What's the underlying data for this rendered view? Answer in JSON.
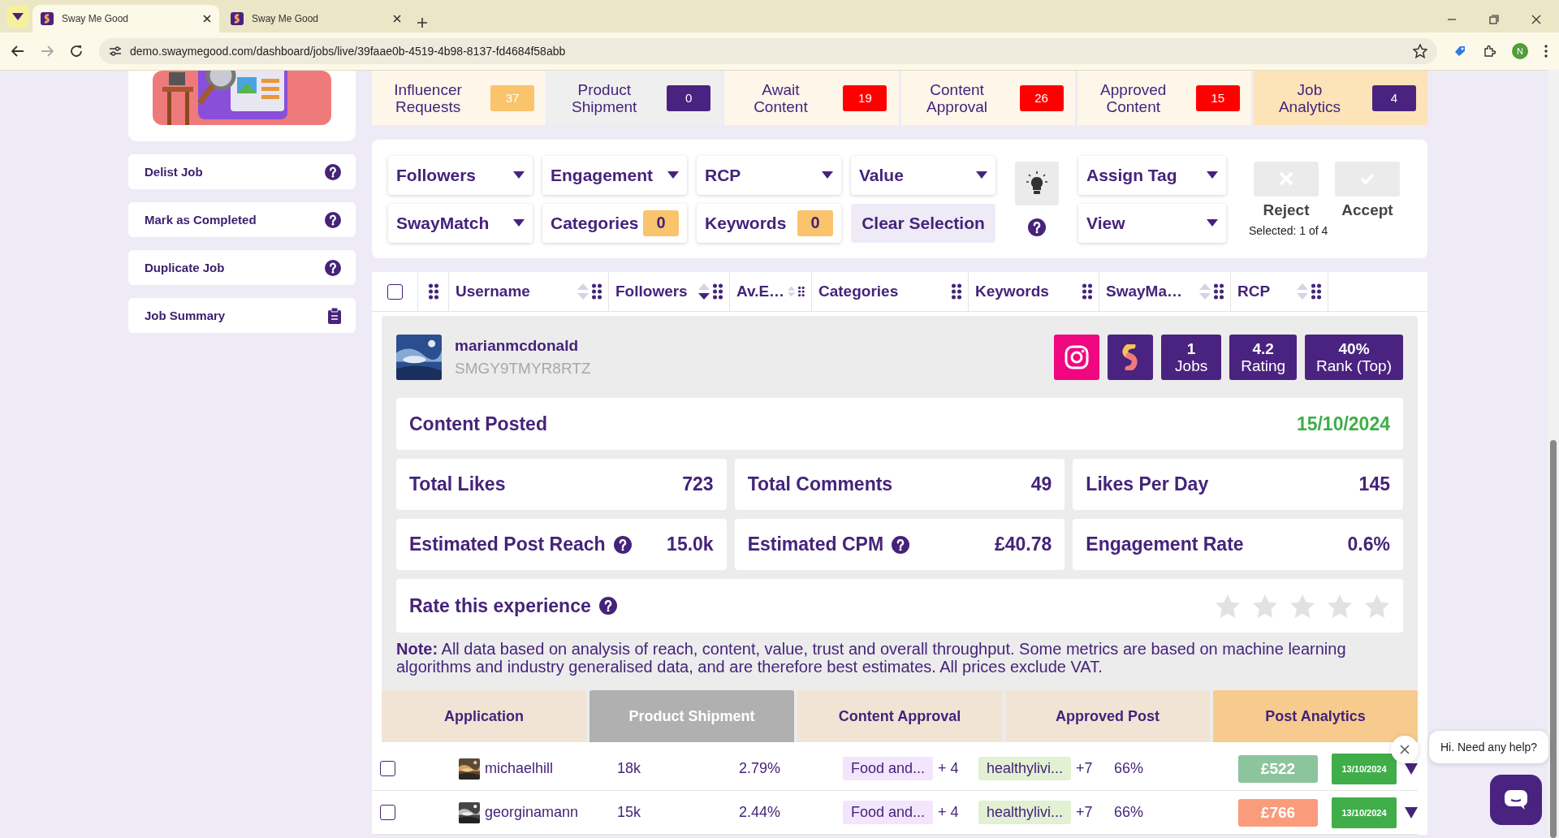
{
  "browser": {
    "tabs": [
      {
        "title": "Sway Me Good",
        "selected": true
      },
      {
        "title": "Sway Me Good",
        "selected": false
      }
    ],
    "url": "demo.swaymegood.com/dashboard/jobs/live/39faae0b-4519-4b98-8137-fd4684f58abb",
    "profile_initial": "N"
  },
  "sidebar": {
    "actions": [
      {
        "label": "Delist Job",
        "kind": "action"
      },
      {
        "label": "Mark as Completed",
        "kind": "action"
      },
      {
        "label": "Duplicate Job",
        "kind": "action"
      },
      {
        "label": "Job Summary",
        "kind": "summary"
      }
    ]
  },
  "stage_tabs": [
    {
      "label": "Influencer Requests",
      "count": "37",
      "color": "#f9c46b",
      "selected": false,
      "disabled": false
    },
    {
      "label": "Product Shipment",
      "count": "0",
      "color": "#4a2381",
      "selected": false,
      "disabled": true
    },
    {
      "label": "Await Content",
      "count": "19",
      "color": "#ff0000",
      "selected": false,
      "disabled": false
    },
    {
      "label": "Content Approval",
      "count": "26",
      "color": "#ff0000",
      "selected": false,
      "disabled": false
    },
    {
      "label": "Approved Content",
      "count": "15",
      "color": "#ff0000",
      "selected": false,
      "disabled": false
    },
    {
      "label": "Job Analytics",
      "count": "4",
      "color": "#4a2381",
      "selected": true,
      "disabled": false
    }
  ],
  "filters": {
    "items": [
      {
        "kind": "dropdown",
        "label": "Followers"
      },
      {
        "kind": "dropdown",
        "label": "Engagement"
      },
      {
        "kind": "dropdown",
        "label": "RCP"
      },
      {
        "kind": "dropdown",
        "label": "Value"
      },
      {
        "kind": "dropdown",
        "label": "SwayMatch"
      },
      {
        "kind": "counter",
        "label": "Categories",
        "count": "0"
      },
      {
        "kind": "counter",
        "label": "Keywords",
        "count": "0"
      },
      {
        "kind": "button",
        "label": "Clear Selection"
      }
    ],
    "tag_controls": [
      {
        "label": "Assign Tag"
      },
      {
        "label": "View"
      }
    ],
    "actions": [
      {
        "kind": "reject",
        "label": "Reject",
        "disabled": true
      },
      {
        "kind": "accept",
        "label": "Accept",
        "disabled": true
      }
    ],
    "selection": "Selected: 1 of 4"
  },
  "table": {
    "header_checked": false,
    "columns": [
      {
        "label": "Username",
        "sortable": true,
        "sorted": false
      },
      {
        "label": "Followers",
        "sortable": true,
        "sorted": true
      },
      {
        "label": "Av.E…",
        "sortable": true,
        "sorted": false
      },
      {
        "label": "Categories",
        "sortable": false
      },
      {
        "label": "Keywords",
        "sortable": false
      },
      {
        "label": "SwayMa…",
        "sortable": true,
        "sorted": false
      },
      {
        "label": "RCP",
        "sortable": true,
        "sorted": false
      }
    ]
  },
  "expanded": {
    "username": "marianmcdonald",
    "code": "SMGY9TMYR8RTZ",
    "badges": [
      {
        "kind": "instagram"
      },
      {
        "kind": "swaymatch"
      },
      {
        "kind": "stat",
        "value": "1",
        "label": "Jobs"
      },
      {
        "kind": "stat",
        "value": "4.2",
        "label": "Rating"
      },
      {
        "kind": "stat",
        "value": "40%",
        "label": "Rank (Top)"
      }
    ],
    "content_posted": {
      "label": "Content Posted",
      "date": "15/10/2024"
    },
    "metrics": [
      {
        "label": "Total Likes",
        "value": "723",
        "help": false
      },
      {
        "label": "Total Comments",
        "value": "49",
        "help": false
      },
      {
        "label": "Likes Per Day",
        "value": "145",
        "help": false
      },
      {
        "label": "Estimated Post Reach",
        "value": "15.0k",
        "help": true
      },
      {
        "label": "Estimated CPM",
        "value": "£40.78",
        "help": true
      },
      {
        "label": "Engagement Rate",
        "value": "0.6%",
        "help": false
      }
    ],
    "rating": {
      "label": "Rate this experience",
      "stars": 0
    },
    "note": "**Note:** All data based on analysis of reach, content, value, trust and overall throughput. Some metrics are based on machine learning algorithms and industry generalised data, and are therefore best estimates. All prices exclude VAT."
  },
  "stages": [
    {
      "label": "Application",
      "selected": false,
      "disabled": false
    },
    {
      "label": "Product Shipment",
      "selected": false,
      "disabled": true
    },
    {
      "label": "Content Approval",
      "selected": false,
      "disabled": false
    },
    {
      "label": "Approved Post",
      "selected": false,
      "disabled": false
    },
    {
      "label": "Post Analytics",
      "selected": true,
      "disabled": false
    }
  ],
  "rows": [
    {
      "checked": false,
      "username": "michaelhill",
      "followers": "18k",
      "engagement": "2.79%",
      "category": "Food and...",
      "category_more": "+ 4",
      "keyword": "healthylivi...",
      "keyword_more": "+7",
      "swaymatch": "66%",
      "rcp": "£522",
      "color": "#8cc49e",
      "date": "13/10/2024"
    },
    {
      "checked": false,
      "username": "georginamann",
      "followers": "15k",
      "engagement": "2.44%",
      "category": "Food and...",
      "category_more": "+ 4",
      "keyword": "healthylivi...",
      "keyword_more": "+7",
      "swaymatch": "66%",
      "rcp": "£766",
      "color": "#fa9b7b",
      "date": "13/10/2024"
    }
  ],
  "chat": {
    "message": "Hi. Need any help?"
  }
}
